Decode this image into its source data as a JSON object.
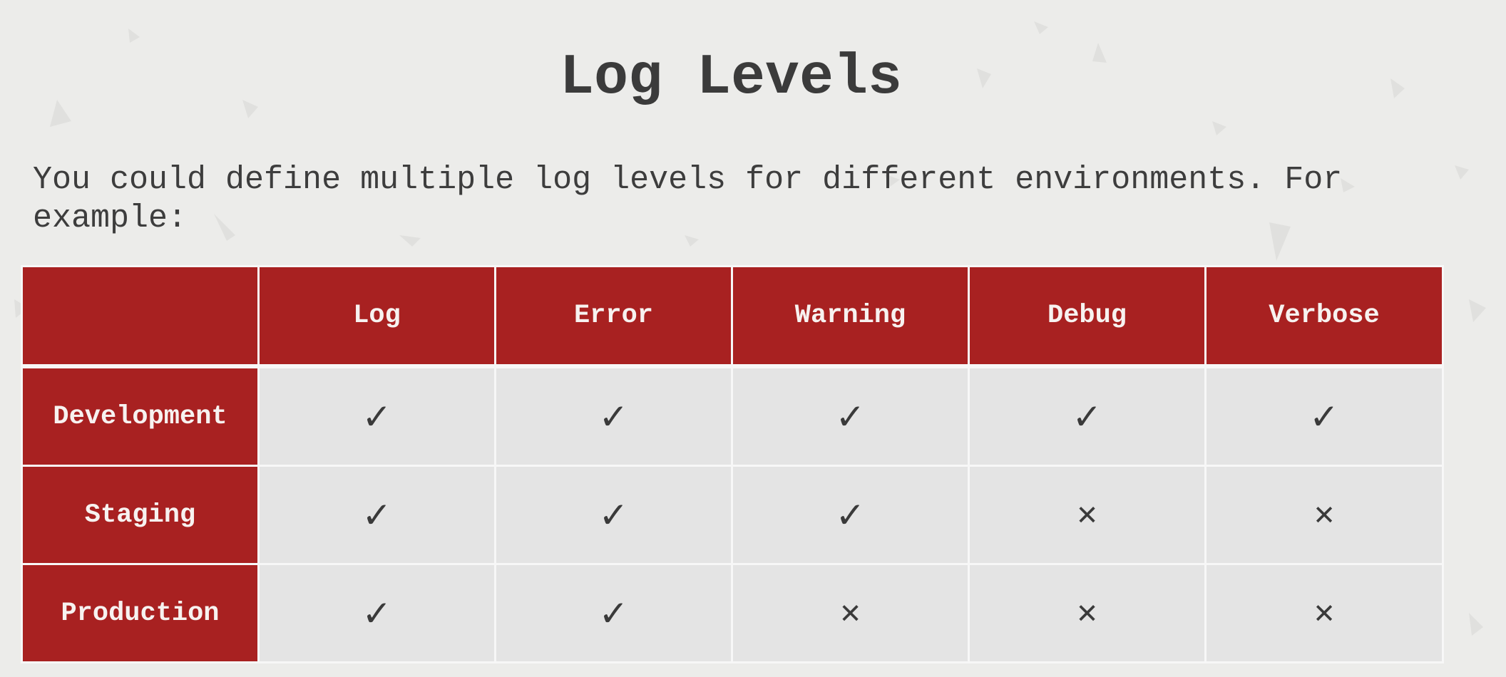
{
  "slide": {
    "title": "Log Levels",
    "intro": "You could define multiple log levels for different environments. For example:"
  },
  "table": {
    "corner": "",
    "columns": [
      "Log",
      "Error",
      "Warning",
      "Debug",
      "Verbose"
    ],
    "rows": [
      {
        "label": "Development",
        "cells": [
          {
            "glyph": "✓",
            "icon": "check-icon"
          },
          {
            "glyph": "✓",
            "icon": "check-icon"
          },
          {
            "glyph": "✓",
            "icon": "check-icon"
          },
          {
            "glyph": "✓",
            "icon": "check-icon"
          },
          {
            "glyph": "✓",
            "icon": "check-icon"
          }
        ]
      },
      {
        "label": "Staging",
        "cells": [
          {
            "glyph": "✓",
            "icon": "check-icon"
          },
          {
            "glyph": "✓",
            "icon": "check-icon"
          },
          {
            "glyph": "✓",
            "icon": "check-icon"
          },
          {
            "glyph": "✕",
            "icon": "cross-icon"
          },
          {
            "glyph": "✕",
            "icon": "cross-icon"
          }
        ]
      },
      {
        "label": "Production",
        "cells": [
          {
            "glyph": "✓",
            "icon": "check-icon"
          },
          {
            "glyph": "✓",
            "icon": "check-icon"
          },
          {
            "glyph": "✕",
            "icon": "cross-icon"
          },
          {
            "glyph": "✕",
            "icon": "cross-icon"
          },
          {
            "glyph": "✕",
            "icon": "cross-icon"
          }
        ]
      }
    ]
  },
  "colors": {
    "header_bg": "#a82121",
    "cell_bg": "#e4e4e4",
    "page_bg": "#ececea",
    "text": "#3a3a3a"
  }
}
